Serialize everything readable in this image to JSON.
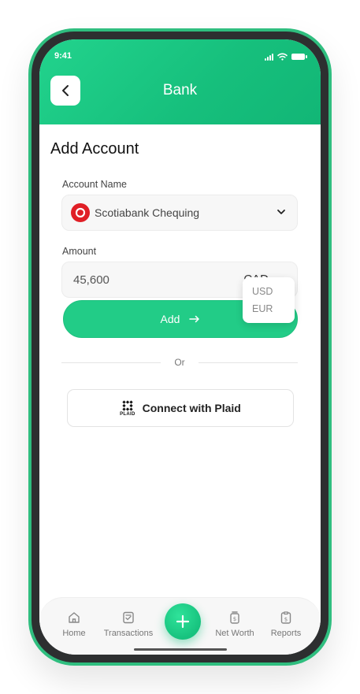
{
  "status_bar": {
    "time": "9:41"
  },
  "header": {
    "title": "Bank",
    "back_icon": "chevron-left-icon"
  },
  "page": {
    "title": "Add Account"
  },
  "account_name": {
    "label": "Account Name",
    "value": "Scotiabank Chequing",
    "logo_color": "#e01f26",
    "dropdown_icon": "chevron-down-icon"
  },
  "amount": {
    "label": "Amount",
    "value": "45,600",
    "currency": "CAD",
    "currency_options": [
      "USD",
      "EUR"
    ]
  },
  "add_button": {
    "label": "Add",
    "icon": "arrow-right-icon"
  },
  "divider": {
    "text": "Or"
  },
  "plaid": {
    "logo_word": "PLAID",
    "label": "Connect with Plaid"
  },
  "tabbar": {
    "items": [
      {
        "label": "Home",
        "icon": "home-icon"
      },
      {
        "label": "Transactions",
        "icon": "transactions-icon"
      },
      {
        "label": "Net Worth",
        "icon": "net-worth-icon"
      },
      {
        "label": "Reports",
        "icon": "reports-icon"
      }
    ],
    "fab_icon": "plus-icon"
  },
  "colors": {
    "accent": "#22cc87",
    "frame": "#2fbe7f"
  }
}
